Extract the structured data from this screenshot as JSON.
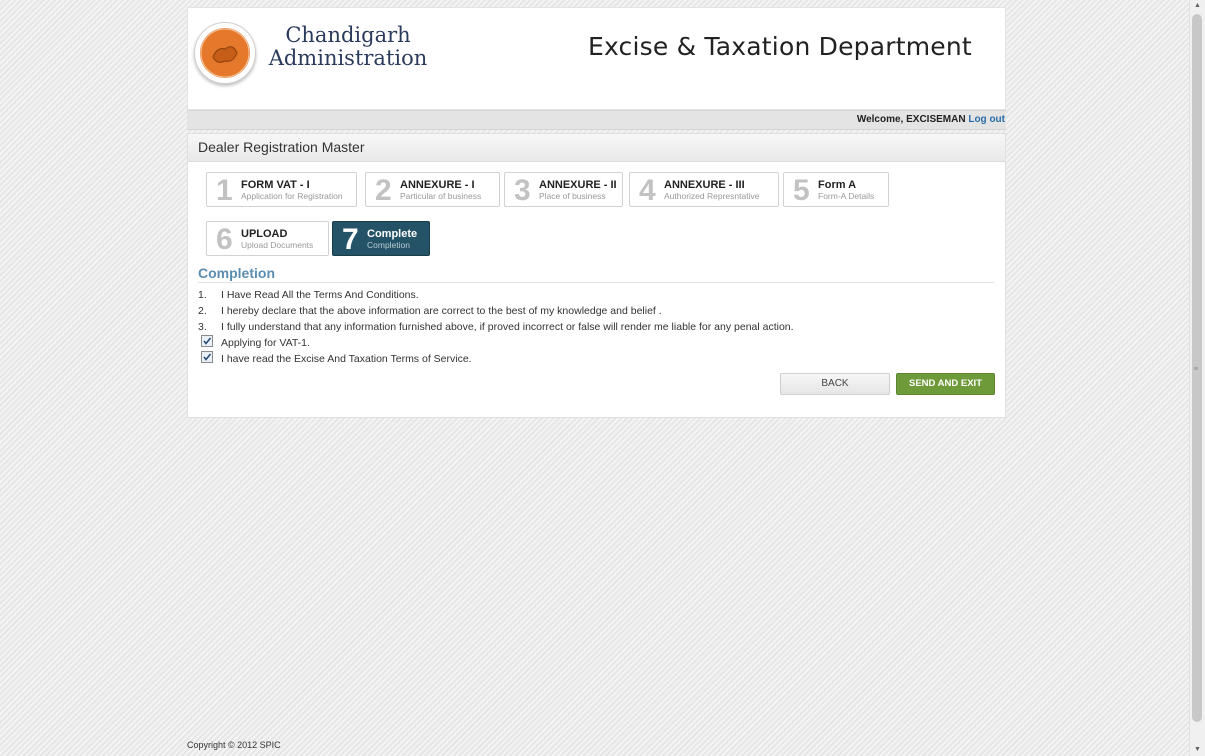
{
  "header": {
    "org_name": "Chandigarh Administration",
    "dept_name": "Excise & Taxation Department"
  },
  "welcome": {
    "text": "Welcome, EXCISEMAN",
    "logout_label": "Log out"
  },
  "panel": {
    "title": "Dealer Registration Master"
  },
  "steps": [
    {
      "num": "1",
      "title": "FORM VAT - I",
      "sub": "Application for Registration"
    },
    {
      "num": "2",
      "title": "ANNEXURE - I",
      "sub": "Particular of business"
    },
    {
      "num": "3",
      "title": "ANNEXURE - II",
      "sub": "Place of business"
    },
    {
      "num": "4",
      "title": "ANNEXURE - III",
      "sub": "Authorized Represntative"
    },
    {
      "num": "5",
      "title": "Form A",
      "sub": "Form-A Details"
    },
    {
      "num": "6",
      "title": "UPLOAD",
      "sub": "Upload Documents"
    },
    {
      "num": "7",
      "title": "Complete",
      "sub": "Completion"
    }
  ],
  "completion": {
    "heading": "Completion",
    "terms": [
      {
        "n": "1.",
        "text": "I Have Read All the Terms And Conditions."
      },
      {
        "n": "2.",
        "text": "I hereby declare that the above information are correct to the best of my knowledge and belief ."
      },
      {
        "n": "3.",
        "text": "I fully understand that any information furnished above, if proved incorrect or false will render me liable for any penal action."
      }
    ],
    "checkboxes": [
      {
        "label": "Applying for VAT-1.",
        "checked": true
      },
      {
        "label": "I have read the Excise And Taxation Terms of Service.",
        "checked": true
      }
    ]
  },
  "buttons": {
    "back": "BACK",
    "send": "SEND AND EXIT"
  },
  "footer": {
    "copyright": "Copyright © 2012 SPIC"
  },
  "colors": {
    "active_step": "#245266",
    "send_button": "#6e9a39",
    "section_heading": "#5b8db0",
    "link": "#2a6ca8"
  }
}
